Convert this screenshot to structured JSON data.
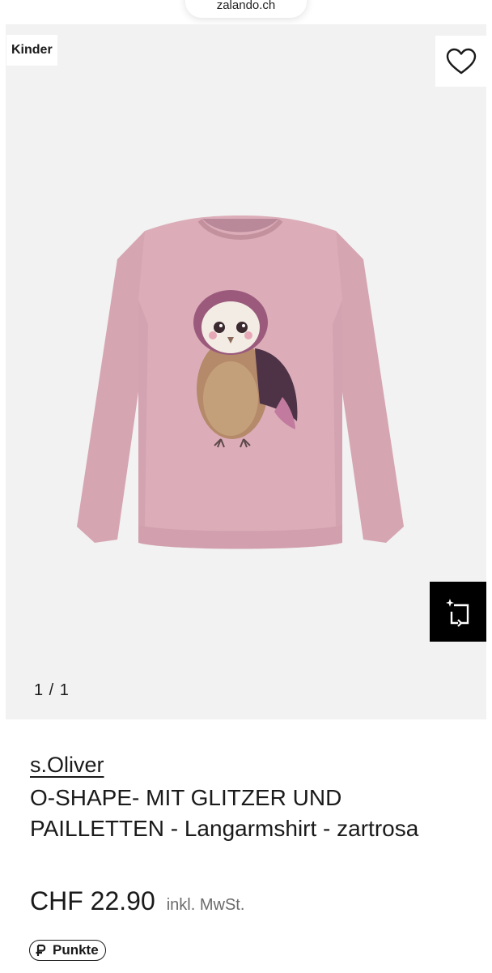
{
  "browser": {
    "url": "zalando.ch"
  },
  "gallery": {
    "badge": "Kinder",
    "pager": "1 / 1",
    "wishlist_icon": "heart-icon",
    "similar_icon": "find-similar-icon"
  },
  "product": {
    "brand": "s.Oliver",
    "title": "O-SHAPE- MIT GLITZER UND PAILLETTEN - Langarmshirt - zartrosa",
    "price": "CHF 22.90",
    "vat_note": "inkl. MwSt.",
    "points_label": "Punkte",
    "points_icon": "p-points-icon"
  },
  "colors": {
    "shirt": "#d9a9b6",
    "gallery_bg": "#f2f2f2",
    "text": "#1a1a1a"
  }
}
